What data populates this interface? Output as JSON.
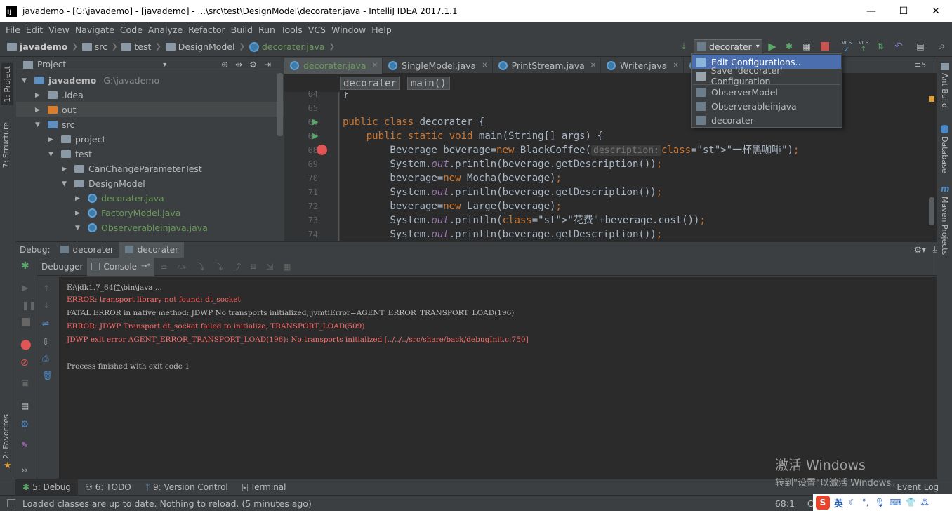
{
  "window": {
    "title": "javademo - [G:\\javademo] - [javademo] - ...\\src\\test\\DesignModel\\decorater.java - IntelliJ IDEA 2017.1.1",
    "logo_text": "IJ",
    "min": "—",
    "max": "☐",
    "close": "✕"
  },
  "menu": [
    "File",
    "Edit",
    "View",
    "Navigate",
    "Code",
    "Analyze",
    "Refactor",
    "Build",
    "Run",
    "Tools",
    "VCS",
    "Window",
    "Help"
  ],
  "breadcrumb": [
    "javademo",
    "src",
    "test",
    "DesignModel",
    "decorater.java"
  ],
  "run_config": {
    "selected": "decorater",
    "arrow": "▾"
  },
  "toolbar": {
    "vcs1": "VCS",
    "vcs2": "VCS"
  },
  "config_popup": {
    "items": [
      {
        "label": "Edit Configurations...",
        "selected": true
      },
      {
        "label": "Save 'decorater' Configuration",
        "selected": false
      },
      {
        "label": "ObserverModel",
        "selected": false
      },
      {
        "label": "Observerableinjava",
        "selected": false
      },
      {
        "label": "decorater",
        "selected": false
      }
    ]
  },
  "left_stripe": {
    "project": "1: Project",
    "structure": "7: Structure",
    "favorites": "2: Favorites"
  },
  "right_stripe": {
    "ant": "Ant Build",
    "database": "Database",
    "maven": "Maven Projects",
    "maven_icon": "m"
  },
  "project_panel": {
    "title": "Project",
    "dropdown": "▾",
    "tree": [
      {
        "label": "javademo",
        "extra": "G:\\javademo",
        "indent": 0,
        "arrow": "▼",
        "icon": "module"
      },
      {
        "label": ".idea",
        "indent": 1,
        "arrow": "▶",
        "icon": "folder-gray"
      },
      {
        "label": "out",
        "indent": 1,
        "arrow": "▶",
        "icon": "folder-orange"
      },
      {
        "label": "src",
        "indent": 1,
        "arrow": "▼",
        "icon": "folder-blue"
      },
      {
        "label": "project",
        "indent": 2,
        "arrow": "▶",
        "icon": "folder-gray"
      },
      {
        "label": "test",
        "indent": 2,
        "arrow": "▼",
        "icon": "folder-gray"
      },
      {
        "label": "CanChangeParameterTest",
        "indent": 3,
        "arrow": "▶",
        "icon": "folder-gray"
      },
      {
        "label": "DesignModel",
        "indent": 3,
        "arrow": "▼",
        "icon": "folder-gray"
      },
      {
        "label": "decorater.java",
        "indent": 4,
        "arrow": "▶",
        "icon": "class"
      },
      {
        "label": "FactoryModel.java",
        "indent": 4,
        "arrow": "▶",
        "icon": "class"
      },
      {
        "label": "Observerableinjava.java",
        "indent": 4,
        "arrow": "▼",
        "icon": "class"
      }
    ]
  },
  "editor_tabs": [
    {
      "label": "decorater.java",
      "active": true
    },
    {
      "label": "SingleModel.java",
      "active": false
    },
    {
      "label": "PrintStream.java",
      "active": false
    },
    {
      "label": "Writer.java",
      "active": false
    },
    {
      "label": "Bu",
      "active": false
    }
  ],
  "tab_overflow": "≡5",
  "editor_breadcrumb": [
    "decorater",
    "main()"
  ],
  "line_numbers": [
    "64",
    "65",
    "66",
    "67",
    "68",
    "69",
    "70",
    "71",
    "72",
    "73",
    "74"
  ],
  "code_lines": [
    {
      "t": "}"
    },
    {
      "t": ""
    },
    {
      "t": "public class decorater {"
    },
    {
      "t": "    public static void main(String[] args) {"
    },
    {
      "t": "        Beverage beverage=new BlackCoffee(",
      "hint": "description:",
      "rest": "\"一杯黑咖啡\");"
    },
    {
      "t": "        System.out.println(beverage.getDescription());"
    },
    {
      "t": "        beverage=new Mocha(beverage);"
    },
    {
      "t": "        System.out.println(beverage.getDescription());"
    },
    {
      "t": "        beverage=new Large(beverage);"
    },
    {
      "t": "        System.out.println(\"花费\"+beverage.cost());"
    },
    {
      "t": "        System.out.println(beverage.getDescription());"
    }
  ],
  "debug": {
    "label": "Debug:",
    "tabs": [
      {
        "label": "decorater",
        "active": false
      },
      {
        "label": "decorater",
        "active": true
      }
    ],
    "subtabs": [
      {
        "label": "Debugger",
        "active": false
      },
      {
        "label": "Console",
        "active": true,
        "suffix": "→*"
      }
    ],
    "console": [
      {
        "text": "E:\\jdk1.7_64位\\bin\\java ...",
        "kind": "gray"
      },
      {
        "text": "ERROR: transport library not found: dt_socket",
        "kind": "red"
      },
      {
        "text": "FATAL ERROR in native method: JDWP No transports initialized, jvmtiError=AGENT_ERROR_TRANSPORT_LOAD(196)",
        "kind": "gray"
      },
      {
        "text": "ERROR: JDWP Transport dt_socket failed to initialize, TRANSPORT_LOAD(509)",
        "kind": "red"
      },
      {
        "text": "JDWP exit error AGENT_ERROR_TRANSPORT_LOAD(196): No transports initialized [../../../src/share/back/debugInit.c:750]",
        "kind": "red"
      },
      {
        "text": "",
        "kind": "gray"
      },
      {
        "text": "Process finished with exit code 1",
        "kind": "gray"
      }
    ],
    "more": "››"
  },
  "bottom_tabs": [
    {
      "label": "5: Debug",
      "active": true
    },
    {
      "label": "6: TODO",
      "active": false
    },
    {
      "label": "9: Version Control",
      "active": false
    },
    {
      "label": "Terminal",
      "active": false
    }
  ],
  "event_log": "Event Log",
  "status": {
    "message": "Loaded classes are up to date. Nothing to reload. (5 minutes ago)",
    "position": "68:1",
    "crlf": "CRLF:"
  },
  "watermark": {
    "line1": "激活 Windows",
    "line2": "转到\"设置\"以激活 Windows。"
  },
  "tray": {
    "ime": "S",
    "lang": "英"
  },
  "colors": {
    "accent": "#4b6eaf",
    "green": "#6a9a5a",
    "error": "#ff6b68",
    "keyword": "#cc7832"
  }
}
